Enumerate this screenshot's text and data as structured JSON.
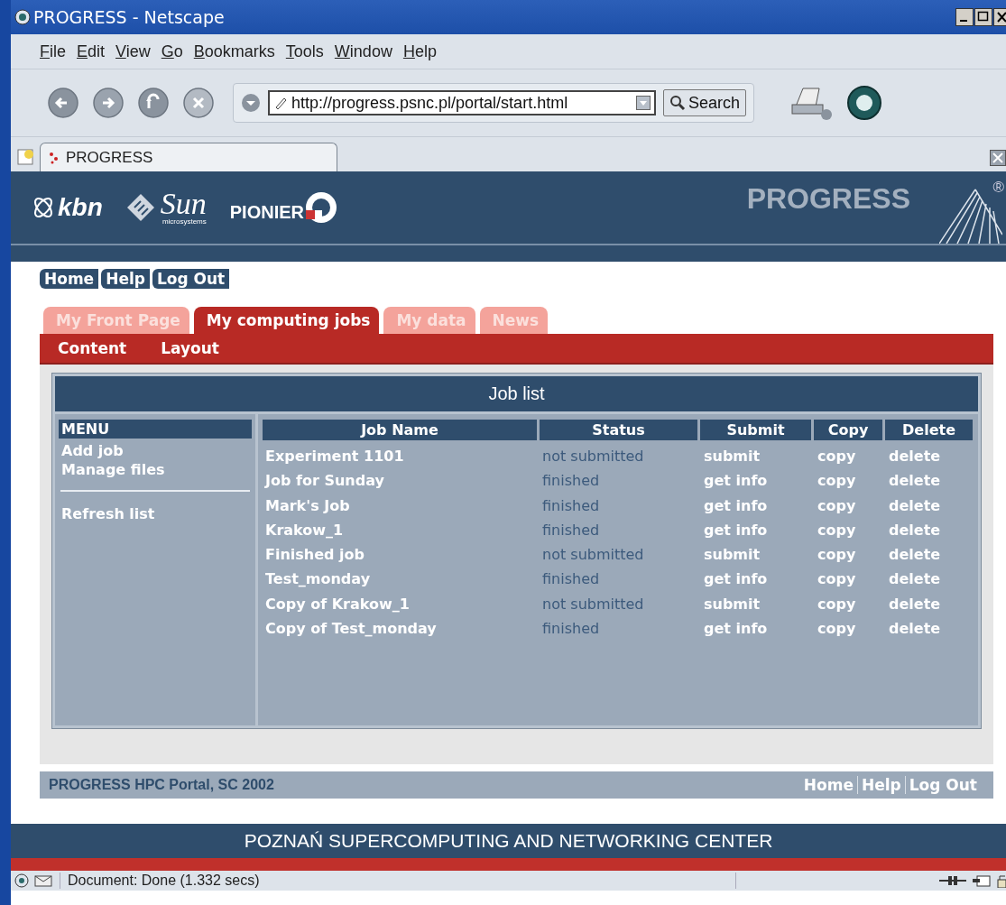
{
  "window": {
    "title": "PROGRESS - Netscape"
  },
  "menu": [
    "File",
    "Edit",
    "View",
    "Go",
    "Bookmarks",
    "Tools",
    "Window",
    "Help"
  ],
  "address": {
    "value": "http://progress.psnc.pl/portal/start.html"
  },
  "search_button": "Search",
  "browser_tabs": [
    {
      "label": "PROGRESS",
      "selected": true
    }
  ],
  "banner": {
    "kbn": "kbn",
    "sun": "Sun",
    "sun_sub": "microsystems",
    "pionier": "PIONIER",
    "progress": "PROGRESS",
    "registered": "®"
  },
  "top_links": [
    "Home",
    "Help",
    "Log Out"
  ],
  "tabs": [
    {
      "label": "My Front Page",
      "selected": false
    },
    {
      "label": "My computing jobs",
      "selected": true
    },
    {
      "label": "My data",
      "selected": false
    },
    {
      "label": "News",
      "selected": false
    }
  ],
  "subnav": [
    "Content",
    "Layout"
  ],
  "job_list": {
    "title": "Job list",
    "menu_title": "MENU",
    "menu_groups": [
      [
        "Add job",
        "Manage files"
      ],
      [
        "Refresh list"
      ]
    ],
    "columns": [
      "Job Name",
      "Status",
      "Submit",
      "Copy",
      "Delete"
    ],
    "rows": [
      {
        "name": "Experiment 1101",
        "status": "not submitted",
        "action": "submit",
        "copy": "copy",
        "delete": "delete"
      },
      {
        "name": "Job for Sunday",
        "status": "finished",
        "action": "get info",
        "copy": "copy",
        "delete": "delete"
      },
      {
        "name": "Mark's Job",
        "status": "finished",
        "action": "get info",
        "copy": "copy",
        "delete": "delete"
      },
      {
        "name": "Krakow_1",
        "status": "finished",
        "action": "get info",
        "copy": "copy",
        "delete": "delete"
      },
      {
        "name": "Finished job",
        "status": "not submitted",
        "action": "submit",
        "copy": "copy",
        "delete": "delete"
      },
      {
        "name": "Test_monday",
        "status": "finished",
        "action": "get info",
        "copy": "copy",
        "delete": "delete"
      },
      {
        "name": "Copy of Krakow_1",
        "status": "not submitted",
        "action": "submit",
        "copy": "copy",
        "delete": "delete"
      },
      {
        "name": "Copy of Test_monday",
        "status": "finished",
        "action": "get info",
        "copy": "copy",
        "delete": "delete"
      }
    ]
  },
  "footer": {
    "text": "PROGRESS HPC Portal, SC 2002",
    "links": [
      "Home",
      "Help",
      "Log Out"
    ]
  },
  "bottom_banner": "POZNAŃ SUPERCOMPUTING AND NETWORKING CENTER",
  "status_bar": "Document: Done (1.332 secs)"
}
